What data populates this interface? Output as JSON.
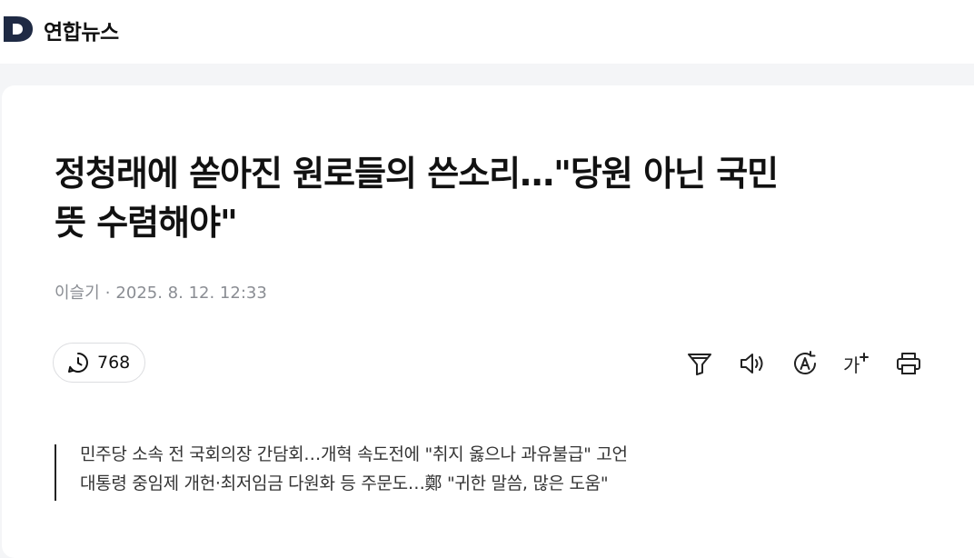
{
  "site": {
    "logo_icon": "D",
    "name": "연합뉴스"
  },
  "article": {
    "title_line1": "정청래에 쏟아진 원로들의 쓴소리…\"당원 아닌 국민",
    "title_line2": "뜻 수렴해야\"",
    "author": "이슬기",
    "separator": "·",
    "datetime": "2025. 8. 12. 12:33",
    "comment_count": "768",
    "summary": [
      "민주당 소속 전 국회의장 간담회…개혁 속도전에 \"취지 옳으나 과유불급\" 고언",
      "대통령 중임제 개헌·최저임금 다원화 등 주문도…鄭 \"귀한 말씀, 많은 도움\""
    ]
  },
  "toolbar": {
    "icons": [
      "filter-icon",
      "speaker-icon",
      "auto-translate-icon",
      "font-size-icon",
      "print-icon"
    ],
    "font_size_glyph": "가"
  },
  "colors": {
    "brand": "#1f2a44",
    "muted": "#8a8d93",
    "page_bg": "#f4f5f7"
  }
}
